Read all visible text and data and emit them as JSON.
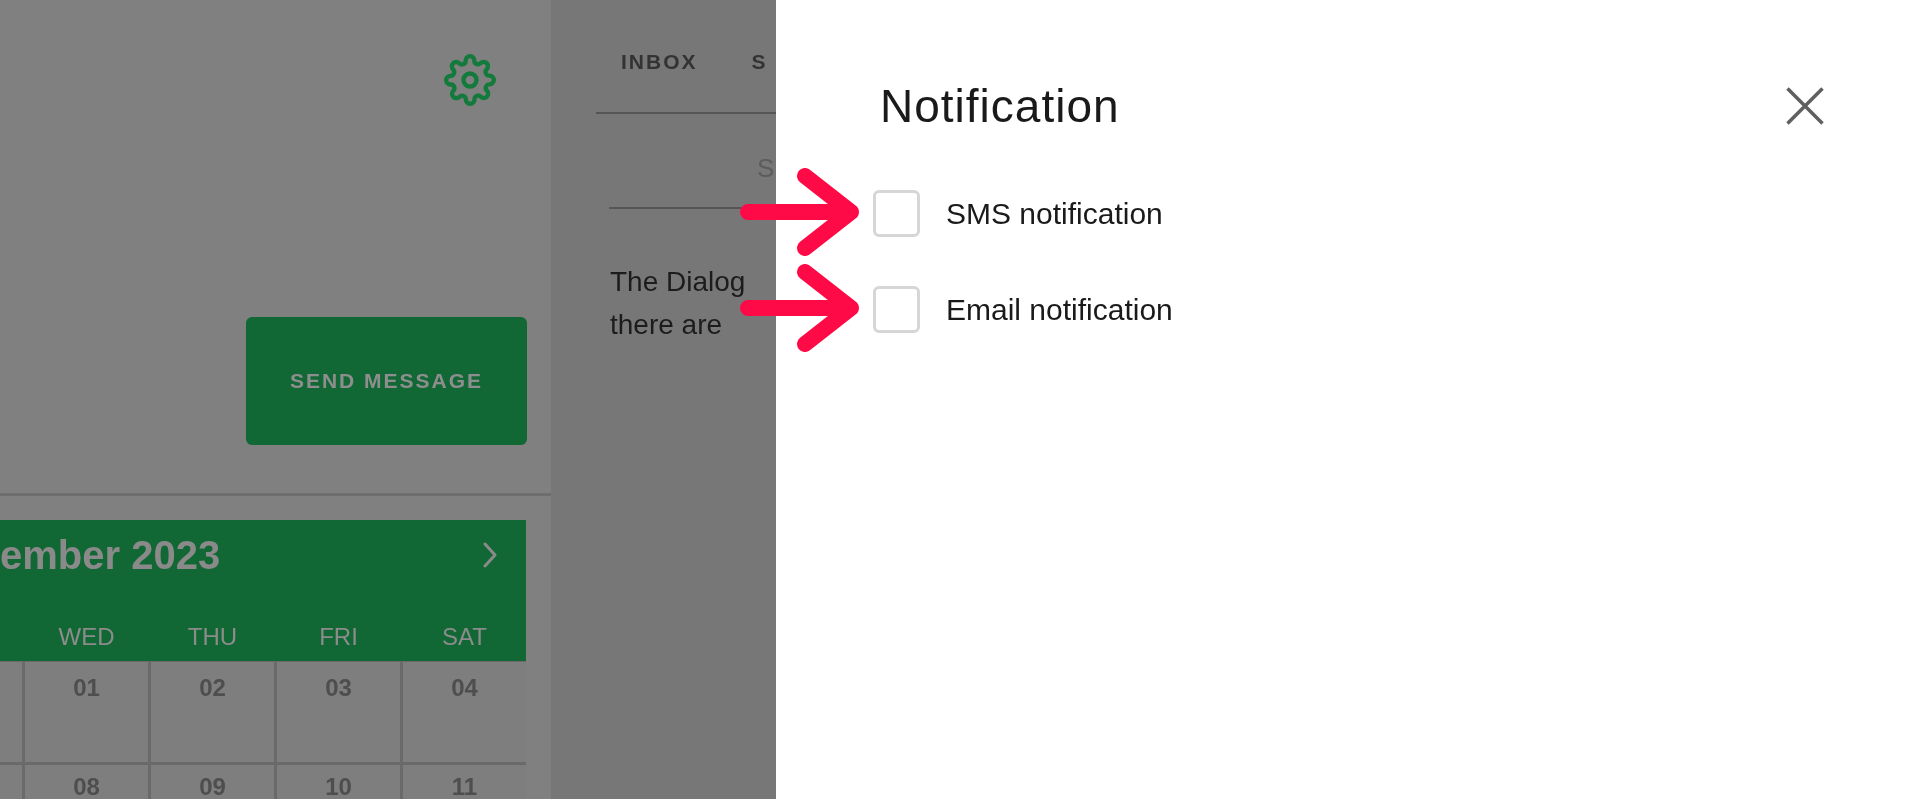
{
  "main": {
    "send_button": "SEND MESSAGE"
  },
  "calendar": {
    "title": "ember 2023",
    "weekdays": [
      "WED",
      "THU",
      "FRI",
      "SAT"
    ],
    "weeks": [
      [
        "01",
        "02",
        "03",
        "04"
      ],
      [
        "08",
        "09",
        "10",
        "11"
      ]
    ]
  },
  "inbox": {
    "tabs": [
      {
        "label": "INBOX"
      },
      {
        "label": "S"
      }
    ],
    "search": {
      "placeholder": "S"
    },
    "message": "The Dialog there are"
  },
  "dialog": {
    "title": "Notification",
    "options": [
      {
        "label": "SMS notification",
        "checked": false
      },
      {
        "label": "Email notification",
        "checked": false
      }
    ]
  }
}
